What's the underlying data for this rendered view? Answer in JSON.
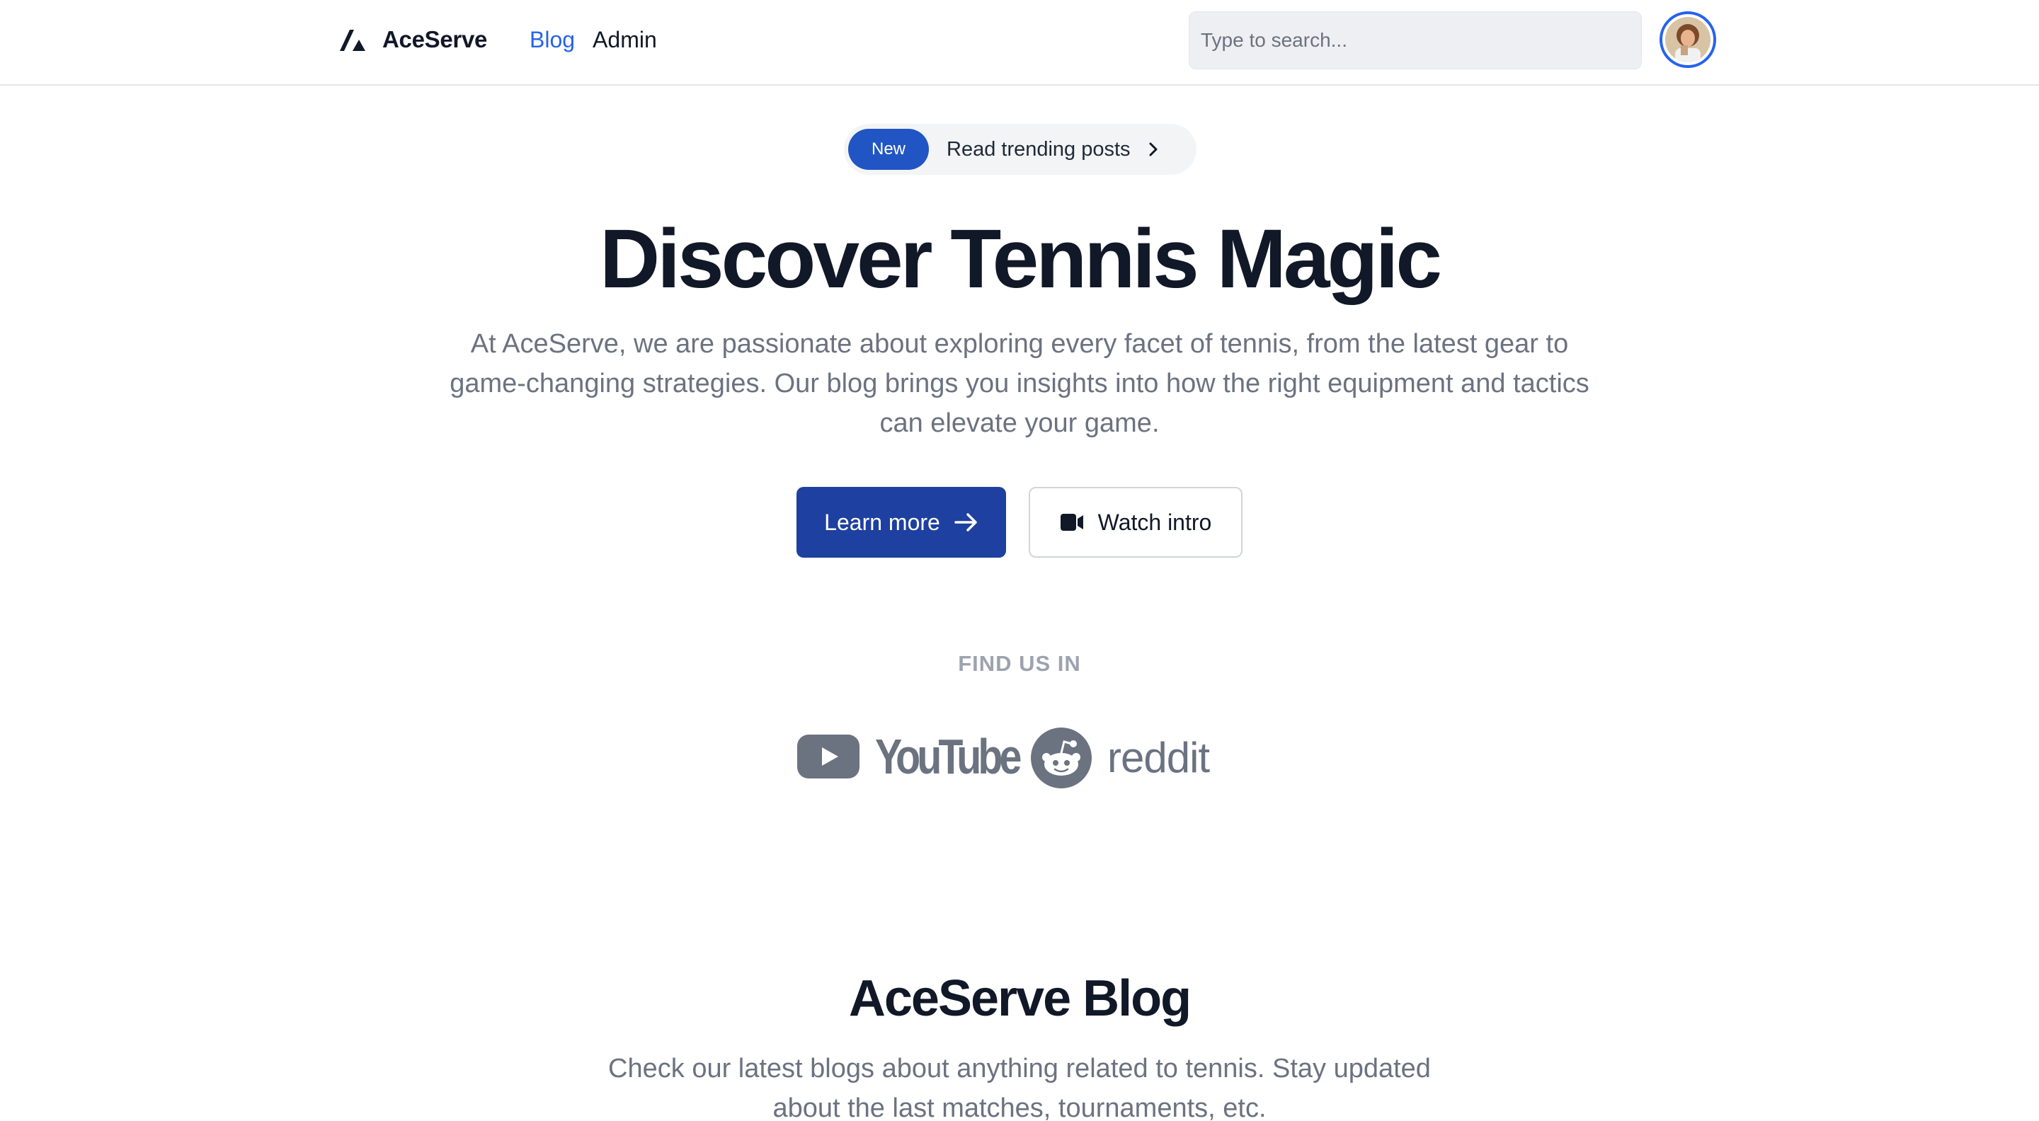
{
  "header": {
    "brand": "AceServe",
    "nav": [
      {
        "label": "Blog",
        "active": true
      },
      {
        "label": "Admin",
        "active": false
      }
    ],
    "search_placeholder": "Type to search...",
    "accent_color": "#2563eb"
  },
  "hero": {
    "badge": "New",
    "announcement": "Read trending posts",
    "title": "Discover Tennis Magic",
    "description": "At AceServe, we are passionate about exploring every facet of tennis, from the latest gear to game-changing strategies. Our blog brings you insights into how the right equipment and tactics can elevate your game.",
    "primary_button": "Learn more",
    "secondary_button": "Watch intro",
    "primary_color": "#1e40a0"
  },
  "social": {
    "heading": "FIND US IN",
    "logos": [
      {
        "name": "youtube-logo",
        "label": "YouTube"
      },
      {
        "name": "reddit-logo",
        "label": "reddit"
      }
    ]
  },
  "blog": {
    "title": "AceServe Blog",
    "description": "Check our latest blogs about anything related to tennis. Stay updated about the last matches, tournaments, etc."
  }
}
